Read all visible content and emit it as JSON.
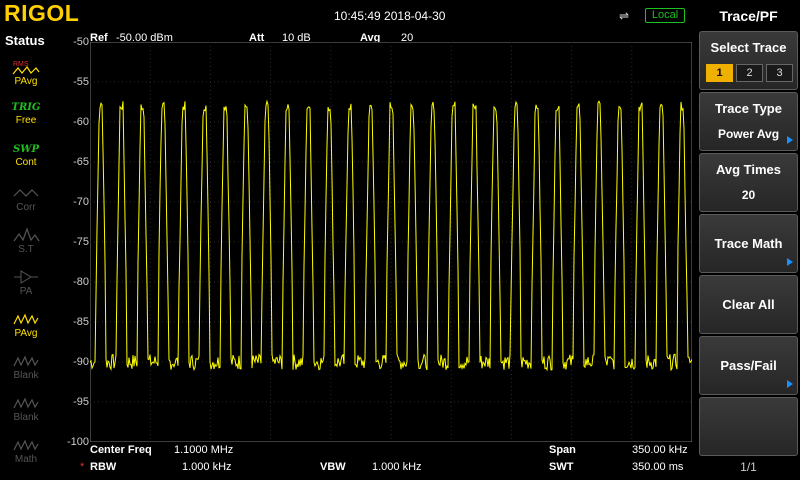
{
  "header": {
    "logo": "RIGOL",
    "datetime": "10:45:49 2018-04-30",
    "usb_icon": "usb-icon",
    "local_label": "Local"
  },
  "status_panel": {
    "title": "Status",
    "items": [
      {
        "top": "RMS",
        "label": "PAvg",
        "active": true,
        "icon": "power-avg-icon"
      },
      {
        "top": "TRIG",
        "label": "Free",
        "active": true,
        "icon": "trigger-icon"
      },
      {
        "top": "SWP",
        "label": "Cont",
        "active": true,
        "icon": "sweep-icon"
      },
      {
        "top": "",
        "label": "Corr",
        "active": false,
        "icon": "correction-icon"
      },
      {
        "top": "",
        "label": "S.T",
        "active": false,
        "icon": "signal-track-icon"
      },
      {
        "top": "",
        "label": "PA",
        "active": false,
        "icon": "preamp-icon"
      },
      {
        "top": "",
        "label": "PAvg",
        "active": true,
        "icon": "trace-pavg-icon"
      },
      {
        "top": "",
        "label": "Blank",
        "active": false,
        "icon": "trace-blank-icon"
      },
      {
        "top": "",
        "label": "Blank",
        "active": false,
        "icon": "trace-blank-icon"
      },
      {
        "top": "",
        "label": "Math",
        "active": false,
        "icon": "trace-math-icon"
      }
    ]
  },
  "measurement_header": {
    "ref_label": "Ref",
    "ref_value": "-50.00 dBm",
    "att_label": "Att",
    "att_value": "10 dB",
    "avg_label": "Avg",
    "avg_value": "20"
  },
  "footer": {
    "center_freq_label": "Center Freq",
    "center_freq_value": "1.1000 MHz",
    "span_label": "Span",
    "span_value": "350.00 kHz",
    "rbw_star": "*",
    "rbw_label": "RBW",
    "rbw_value": "1.000 kHz",
    "vbw_label": "VBW",
    "vbw_value": "1.000 kHz",
    "swt_label": "SWT",
    "swt_value": "350.00 ms"
  },
  "chart_data": {
    "type": "line",
    "y_tick_labels": [
      "-50",
      "-55",
      "-60",
      "-65",
      "-70",
      "-75",
      "-80",
      "-85",
      "-90",
      "-95",
      "-100"
    ],
    "ylim": [
      -100,
      -50
    ],
    "xlim_khz": [
      925,
      1275
    ],
    "grid": true,
    "trace_color": "#ffff00",
    "series": [
      {
        "peak_count": 29,
        "peak_level_dbm": -58,
        "noise_floor_dbm": -90
      }
    ]
  },
  "menu": {
    "title": "Trace/PF",
    "select_trace": {
      "label": "Select Trace",
      "options": [
        "1",
        "2",
        "3"
      ],
      "selected": "1"
    },
    "trace_type": {
      "label": "Trace Type",
      "value": "Power Avg"
    },
    "avg_times": {
      "label": "Avg Times",
      "value": "20"
    },
    "trace_math": {
      "label": "Trace Math"
    },
    "clear_all": {
      "label": "Clear All"
    },
    "pass_fail": {
      "label": "Pass/Fail"
    },
    "page": "1/1"
  },
  "colors": {
    "logo": "#ffcf00",
    "trace": "#ffff00",
    "local_badge": "#21c021",
    "menu_arrow": "#1a8fff",
    "selected_trace": "#f0b000",
    "rbw_star": "#e03030"
  }
}
